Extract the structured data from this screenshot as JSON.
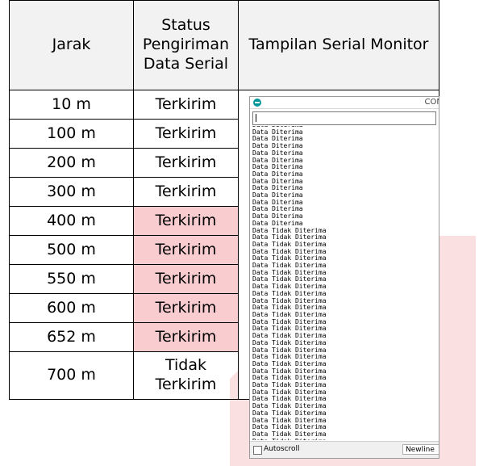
{
  "headers": {
    "jarak": "Jarak",
    "status": "Status Pengiriman Data Serial",
    "tampilan": "Tampilan Serial Monitor"
  },
  "rows": [
    {
      "jarak": "10 m",
      "status": "Terkirim"
    },
    {
      "jarak": "100 m",
      "status": "Terkirim"
    },
    {
      "jarak": "200 m",
      "status": "Terkirim"
    },
    {
      "jarak": "300 m",
      "status": "Terkirim"
    },
    {
      "jarak": "400 m",
      "status": "Terkirim"
    },
    {
      "jarak": "500 m",
      "status": "Terkirim"
    },
    {
      "jarak": "550 m",
      "status": "Terkirim"
    },
    {
      "jarak": "600 m",
      "status": "Terkirim"
    },
    {
      "jarak": "652 m",
      "status": "Terkirim"
    },
    {
      "jarak": "700 m",
      "status": "Tidak Terkirim"
    }
  ],
  "serial_monitor": {
    "title": "COM",
    "input_value": "",
    "lines": [
      "Data Diterima",
      "Data Diterima",
      "Data Diterima",
      "Data Diterima",
      "Data Diterima",
      "Data Diterima",
      "Data Diterima",
      "Data Diterima",
      "Data Diterima",
      "Data Diterima",
      "Data Diterima",
      "Data Diterima",
      "Data Diterima",
      "Data Diterima",
      "Data Diterima",
      "Data Tidak Diterima",
      "Data Tidak Diterima",
      "Data Tidak Diterima",
      "Data Tidak Diterima",
      "Data Tidak Diterima",
      "Data Tidak Diterima",
      "Data Tidak Diterima",
      "Data Tidak Diterima",
      "Data Tidak Diterima",
      "Data Tidak Diterima",
      "Data Tidak Diterima",
      "Data Tidak Diterima",
      "Data Tidak Diterima",
      "Data Tidak Diterima",
      "Data Tidak Diterima",
      "Data Tidak Diterima",
      "Data Tidak Diterima",
      "Data Tidak Diterima",
      "Data Tidak Diterima",
      "Data Tidak Diterima",
      "Data Tidak Diterima",
      "Data Tidak Diterima",
      "Data Tidak Diterima",
      "Data Tidak Diterima",
      "Data Tidak Diterima",
      "Data Tidak Diterima",
      "Data Tidak Diterima",
      "Data Tidak Diterima",
      "Data Tidak Diterima",
      "Data Tidak Diterima",
      "Data Tidak Diterima",
      "Data Tidak Diterima",
      "Data Tidak Diterima"
    ],
    "autoscroll_label": "Autoscroll",
    "autoscroll_checked": false,
    "line_ending": "Newline"
  },
  "colors": {
    "highlight": "#f0a0a8",
    "header_bg": "#f2f2f2",
    "arduino_teal": "#00979c"
  }
}
